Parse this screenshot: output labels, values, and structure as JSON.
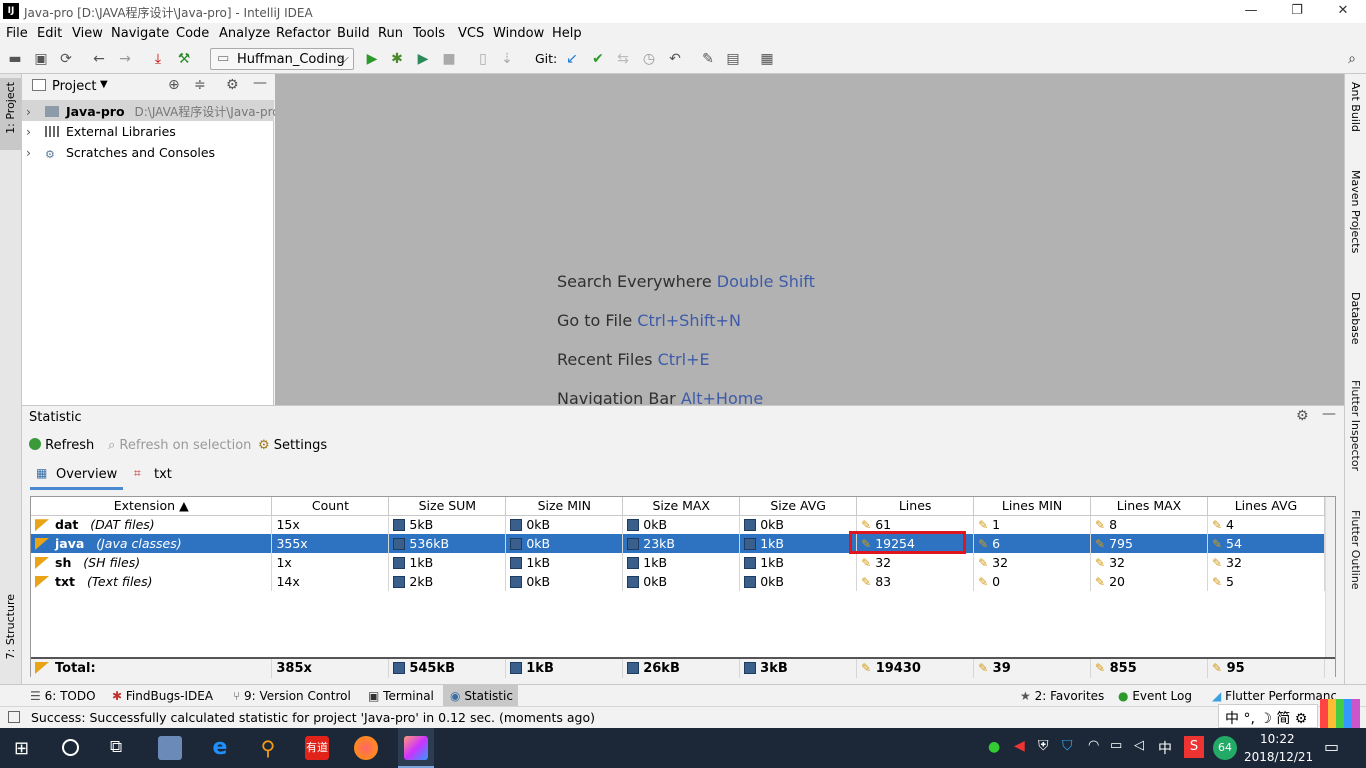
{
  "window": {
    "title": "Java-pro [D:\\JAVA程序设计\\Java-pro] - IntelliJ IDEA",
    "app_icon": "IJ"
  },
  "menu": [
    "File",
    "Edit",
    "View",
    "Navigate",
    "Code",
    "Analyze",
    "Refactor",
    "Build",
    "Run",
    "Tools",
    "VCS",
    "Window",
    "Help"
  ],
  "toolbar": {
    "run_config": "Huffman_Coding",
    "git_label": "Git:"
  },
  "left_tabs": {
    "project": "1: Project",
    "structure": "7: Structure"
  },
  "right_tabs": [
    "Ant Build",
    "Maven Projects",
    "Database",
    "Flutter Inspector",
    "Flutter Outline"
  ],
  "project": {
    "header": "Project",
    "items": [
      {
        "label": "Java-pro",
        "path": "D:\\JAVA程序设计\\Java-pro"
      },
      {
        "label": "External Libraries"
      },
      {
        "label": "Scratches and Consoles"
      }
    ]
  },
  "editor_hints": [
    {
      "text": "Search Everywhere",
      "key": "Double Shift"
    },
    {
      "text": "Go to File",
      "key": "Ctrl+Shift+N"
    },
    {
      "text": "Recent Files",
      "key": "Ctrl+E"
    },
    {
      "text": "Navigation Bar",
      "key": "Alt+Home"
    }
  ],
  "statistic": {
    "title": "Statistic",
    "actions": {
      "refresh": "Refresh",
      "refresh_sel": "Refresh on selection",
      "settings": "Settings"
    },
    "tabs": {
      "overview": "Overview",
      "txt": "txt"
    },
    "columns": [
      "Extension ▲",
      "Count",
      "Size SUM",
      "Size MIN",
      "Size MAX",
      "Size AVG",
      "Lines",
      "Lines MIN",
      "Lines MAX",
      "Lines AVG"
    ],
    "rows": [
      {
        "ext": "dat",
        "desc": "(DAT files)",
        "count": "15x",
        "sum": "5kB",
        "min": "0kB",
        "max": "0kB",
        "avg": "0kB",
        "lines": "61",
        "lmin": "1",
        "lmax": "8",
        "lavg": "4"
      },
      {
        "ext": "java",
        "desc": "(Java classes)",
        "count": "355x",
        "sum": "536kB",
        "min": "0kB",
        "max": "23kB",
        "avg": "1kB",
        "lines": "19254",
        "lmin": "6",
        "lmax": "795",
        "lavg": "54"
      },
      {
        "ext": "sh",
        "desc": "(SH files)",
        "count": "1x",
        "sum": "1kB",
        "min": "1kB",
        "max": "1kB",
        "avg": "1kB",
        "lines": "32",
        "lmin": "32",
        "lmax": "32",
        "lavg": "32"
      },
      {
        "ext": "txt",
        "desc": "(Text files)",
        "count": "14x",
        "sum": "2kB",
        "min": "0kB",
        "max": "0kB",
        "avg": "0kB",
        "lines": "83",
        "lmin": "0",
        "lmax": "20",
        "lavg": "5"
      }
    ],
    "total": {
      "label": "Total:",
      "count": "385x",
      "sum": "545kB",
      "min": "1kB",
      "max": "26kB",
      "avg": "3kB",
      "lines": "19430",
      "lmin": "39",
      "lmax": "855",
      "lavg": "95"
    }
  },
  "bottom_tabs": {
    "todo": "6: TODO",
    "findbugs": "FindBugs-IDEA",
    "vc": "9: Version Control",
    "terminal": "Terminal",
    "statistic": "Statistic",
    "favorites": "2: Favorites",
    "eventlog": "Event Log",
    "flutter": "Flutter Performance"
  },
  "status": "Success: Successfully calculated statistic for project 'Java-pro' in 0.12 sec. (moments ago)",
  "ime": "中 °, ☽ 简 ⚙",
  "taskbar": {
    "time": "10:22",
    "date": "2018/12/21",
    "lang": "中",
    "badge": "64",
    "youdao": "有道"
  }
}
